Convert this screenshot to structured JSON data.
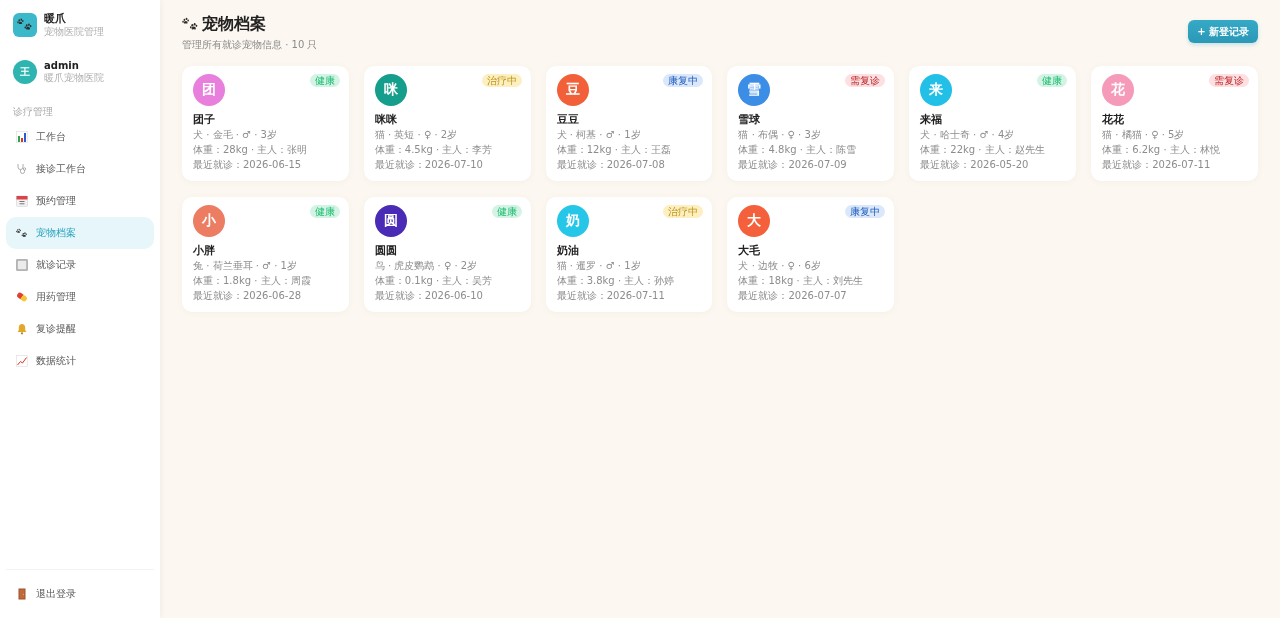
{
  "sidebar": {
    "brand": {
      "name": "暖爪",
      "subtitle": "宠物医院管理"
    },
    "user": {
      "avatar": "王",
      "name": "admin",
      "org": "暖爪宠物医院"
    },
    "section_label": "诊疗管理",
    "items": [
      {
        "label": "工作台",
        "selected": false
      },
      {
        "label": "接诊工作台",
        "selected": false
      },
      {
        "label": "预约管理",
        "selected": false
      },
      {
        "label": "宠物档案",
        "selected": true
      },
      {
        "label": "就诊记录",
        "selected": false
      },
      {
        "label": "用药管理",
        "selected": false
      },
      {
        "label": "复诊提醒",
        "selected": false
      },
      {
        "label": "数据统计",
        "selected": false
      }
    ],
    "logout": "退出登录"
  },
  "header": {
    "title": "宠物档案",
    "subtitle": "管理所有就诊宠物信息 · 10 只",
    "add_button": "+ 新登记录"
  },
  "pets": [
    {
      "avatar": {
        "char": "团",
        "color": "#e97fdc"
      },
      "name": "团子",
      "status": {
        "label": "健康",
        "color": "#d3f4e4"
      },
      "info": "犬 · 金毛 · ♂ · 3岁",
      "weight_owner": "体重：28kg · 主人：张明",
      "last_visit": "最近就诊：2026-06-15"
    },
    {
      "avatar": {
        "char": "咪",
        "color": "#159e8c"
      },
      "name": "咪咪",
      "status": {
        "label": "治疗中",
        "color": "#fdefc0"
      },
      "info": "猫 · 英短 · ♀ · 2岁",
      "weight_owner": "体重：4.5kg · 主人：李芳",
      "last_visit": "最近就诊：2026-07-10"
    },
    {
      "avatar": {
        "char": "豆",
        "color": "#f2603a"
      },
      "name": "豆豆",
      "status": {
        "label": "康复中",
        "color": "#dbe8fc"
      },
      "info": "犬 · 柯基 · ♂ · 1岁",
      "weight_owner": "体重：12kg · 主人：王磊",
      "last_visit": "最近就诊：2026-07-08"
    },
    {
      "avatar": {
        "char": "雪",
        "color": "#3b8de6"
      },
      "name": "雪球",
      "status": {
        "label": "需复诊",
        "color": "#fde0e1"
      },
      "info": "猫 · 布偶 · ♀ · 3岁",
      "weight_owner": "体重：4.8kg · 主人：陈雪",
      "last_visit": "最近就诊：2026-07-09"
    },
    {
      "avatar": {
        "char": "来",
        "color": "#22bfe6"
      },
      "name": "来福",
      "status": {
        "label": "健康",
        "color": "#d3f4e4"
      },
      "info": "犬 · 哈士奇 · ♂ · 4岁",
      "weight_owner": "体重：22kg · 主人：赵先生",
      "last_visit": "最近就诊：2026-05-20"
    },
    {
      "avatar": {
        "char": "花",
        "color": "#f59ab8"
      },
      "name": "花花",
      "status": {
        "label": "需复诊",
        "color": "#fde0e1"
      },
      "info": "猫 · 橘猫 · ♀ · 5岁",
      "weight_owner": "体重：6.2kg · 主人：林悦",
      "last_visit": "最近就诊：2026-07-11"
    },
    {
      "avatar": {
        "char": "小",
        "color": "#ec7c62"
      },
      "name": "小胖",
      "status": {
        "label": "健康",
        "color": "#d3f4e4"
      },
      "info": "兔 · 荷兰垂耳 · ♂ · 1岁",
      "weight_owner": "体重：1.8kg · 主人：周霞",
      "last_visit": "最近就诊：2026-06-28"
    },
    {
      "avatar": {
        "char": "圆",
        "color": "#4a2bb5"
      },
      "name": "圆圆",
      "status": {
        "label": "健康",
        "color": "#d3f4e4"
      },
      "info": "鸟 · 虎皮鹦鹉 · ♀ · 2岁",
      "weight_owner": "体重：0.1kg · 主人：吴芳",
      "last_visit": "最近就诊：2026-06-10"
    },
    {
      "avatar": {
        "char": "奶",
        "color": "#26c6e8"
      },
      "name": "奶油",
      "status": {
        "label": "治疗中",
        "color": "#fdefc0"
      },
      "info": "猫 · 暹罗 · ♂ · 1岁",
      "weight_owner": "体重：3.8kg · 主人：孙婷",
      "last_visit": "最近就诊：2026-07-11"
    },
    {
      "avatar": {
        "char": "大",
        "color": "#f4603c"
      },
      "name": "大毛",
      "status": {
        "label": "康复中",
        "color": "#dbe8fc"
      },
      "info": "犬 · 边牧 · ♀ · 6岁",
      "weight_owner": "体重：18kg · 主人：刘先生",
      "last_visit": "最近就诊：2026-07-07"
    }
  ]
}
